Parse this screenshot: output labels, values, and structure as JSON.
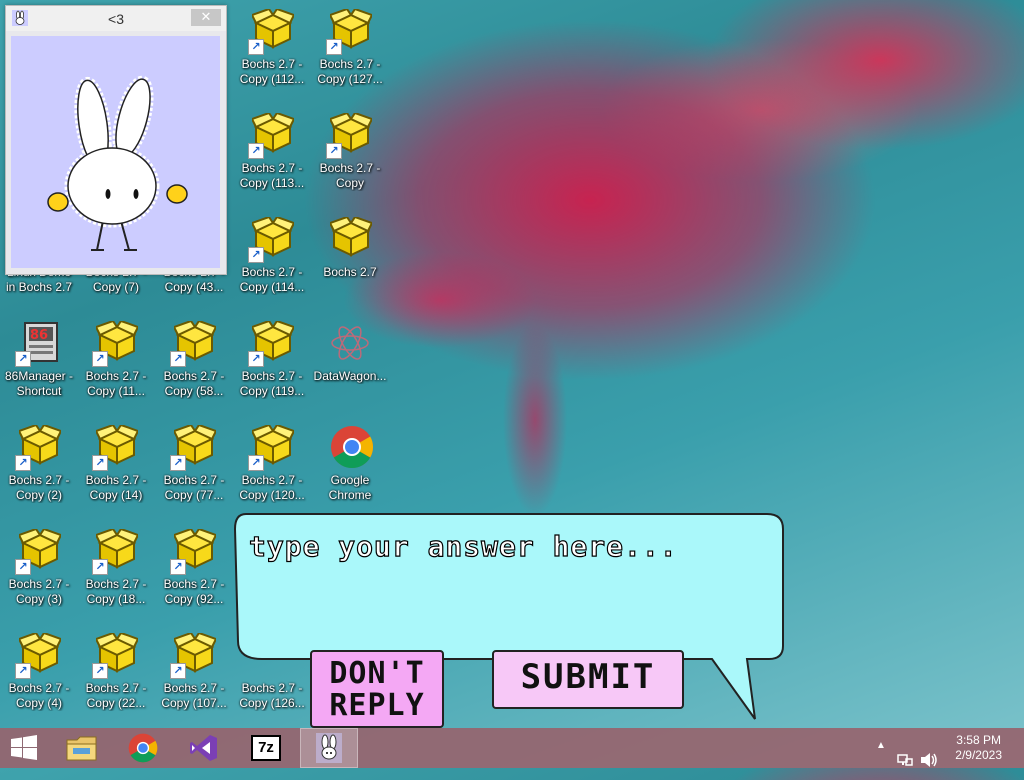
{
  "bunny_window": {
    "title": "<3",
    "close_glyph": "✕"
  },
  "desktop_icons": [
    {
      "label_1": "Bochs 2.7 -",
      "label_2": "Copy (112..."
    },
    {
      "label_1": "Bochs 2.7 -",
      "label_2": "Copy (127..."
    },
    {
      "label_1": "Bochs 2.7 -",
      "label_2": "Copy (113..."
    },
    {
      "label_1": "Bochs 2.7 -",
      "label_2": "Copy"
    },
    {
      "label_1": "Linux Demo",
      "label_2": "in Bochs 2.7"
    },
    {
      "label_1": "Bochs 2.7 -",
      "label_2": "Copy (7)"
    },
    {
      "label_1": "Bochs 2.7 -",
      "label_2": "Copy (43..."
    },
    {
      "label_1": "Bochs 2.7 -",
      "label_2": "Copy (114..."
    },
    {
      "label_1": "Bochs 2.7",
      "label_2": ""
    },
    {
      "label_1": "86Manager -",
      "label_2": "Shortcut"
    },
    {
      "label_1": "Bochs 2.7 -",
      "label_2": "Copy (11..."
    },
    {
      "label_1": "Bochs 2.7 -",
      "label_2": "Copy (58..."
    },
    {
      "label_1": "Bochs 2.7 -",
      "label_2": "Copy (119..."
    },
    {
      "label_1": "DataWagon...",
      "label_2": ""
    },
    {
      "label_1": "Bochs 2.7 -",
      "label_2": "Copy (2)"
    },
    {
      "label_1": "Bochs 2.7 -",
      "label_2": "Copy (14)"
    },
    {
      "label_1": "Bochs 2.7 -",
      "label_2": "Copy (77..."
    },
    {
      "label_1": "Bochs 2.7 -",
      "label_2": "Copy (120..."
    },
    {
      "label_1": "Google",
      "label_2": "Chrome"
    },
    {
      "label_1": "Bochs 2.7 -",
      "label_2": "Copy (3)"
    },
    {
      "label_1": "Bochs 2.7 -",
      "label_2": "Copy (18..."
    },
    {
      "label_1": "Bochs 2.7 -",
      "label_2": "Copy (92..."
    },
    {
      "label_1": "Bochs 2.7 -",
      "label_2": "Copy (4)"
    },
    {
      "label_1": "Bochs 2.7 -",
      "label_2": "Copy (22..."
    },
    {
      "label_1": "Bochs 2.7 -",
      "label_2": "Copy (107..."
    },
    {
      "label_1": "Bochs 2.7 -",
      "label_2": "Copy (126..."
    }
  ],
  "dialog": {
    "placeholder": "type your answer here...",
    "dont_reply_line1": "DON'T",
    "dont_reply_line2": "REPLY",
    "submit_label": "SUBMIT"
  },
  "taskbar": {
    "seven_zip_label": "7z",
    "time": "3:58 PM",
    "date": "2/9/2023"
  },
  "colors": {
    "bubble": "#aaf8fa",
    "dont_reply_bg": "#f4a8f4",
    "submit_bg": "#f7c8f7",
    "bunny_bg": "#ccccff"
  }
}
